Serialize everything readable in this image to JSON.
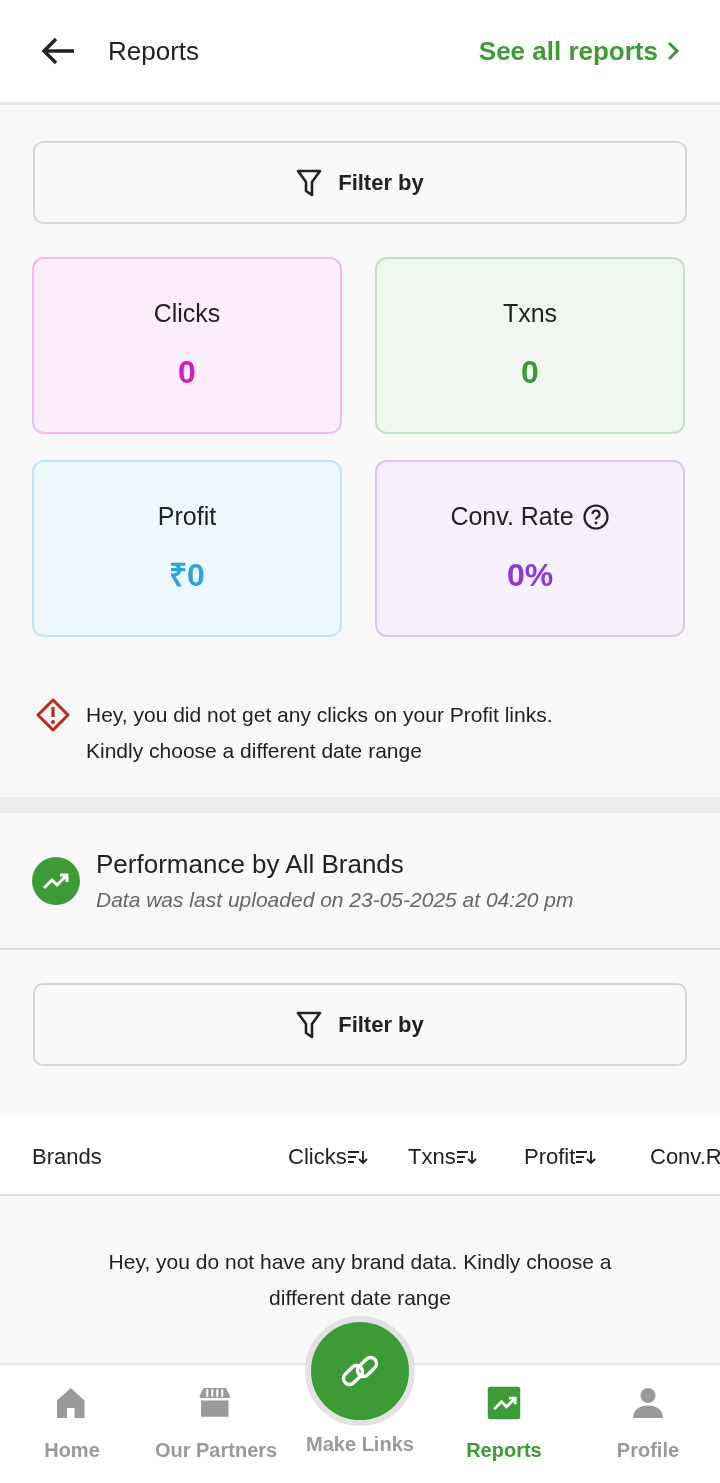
{
  "header": {
    "title": "Reports",
    "link": "See all reports"
  },
  "summary": {
    "filter": "Filter by",
    "stats": [
      {
        "label": "Clicks",
        "value": "0",
        "color": "#cf1fc0",
        "help": false
      },
      {
        "label": "Txns",
        "value": "0",
        "color": "#3c9a36",
        "help": false
      },
      {
        "label": "Profit",
        "value": "₹0",
        "color": "#2aa6dc",
        "help": false
      },
      {
        "label": "Conv. Rate",
        "value": "0%",
        "color": "#8a3ad6",
        "help": true
      }
    ],
    "warning": "Hey, you did not get any clicks on your Profit links. Kindly choose a different date range"
  },
  "performance": {
    "title": "Performance by All Brands",
    "subtitle": "Data was last uploaded on 23-05-2025 at 04:20 pm",
    "filter": "Filter by",
    "table": {
      "columns": [
        {
          "label": "Brands",
          "sortable": false
        },
        {
          "label": "Clicks",
          "sortable": true
        },
        {
          "label": "Txns",
          "sortable": true
        },
        {
          "label": "Profit",
          "sortable": true
        },
        {
          "label": "Conv.R"
        }
      ],
      "empty": "Hey, you do not have any brand data. Kindly choose a different date range"
    }
  },
  "bottom_nav": [
    {
      "label": "Home",
      "kind": "home",
      "selected": false
    },
    {
      "label": "Our Partners",
      "kind": "store",
      "selected": false
    },
    {
      "label": "Make Links",
      "kind": "fab",
      "selected": false
    },
    {
      "label": "Reports",
      "kind": "chart",
      "selected": true
    },
    {
      "label": "Profile",
      "kind": "person",
      "selected": false
    }
  ]
}
